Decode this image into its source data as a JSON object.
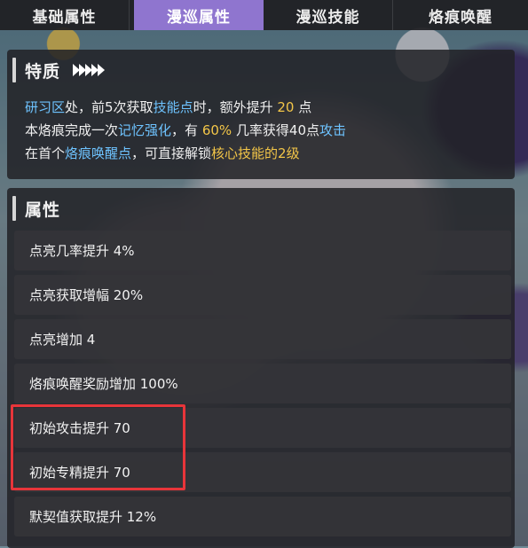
{
  "tabs": [
    {
      "label": "基础属性",
      "active": false
    },
    {
      "label": "漫巡属性",
      "active": true
    },
    {
      "label": "漫巡技能",
      "active": false
    },
    {
      "label": "烙痕唤醒",
      "active": false
    }
  ],
  "trait": {
    "title": "特质",
    "line1": {
      "p1": "研习区",
      "p2": "处，前5次获取",
      "p3": "技能点",
      "p4": "时，额外提升 ",
      "p5": "20",
      "p6": " 点"
    },
    "line2": {
      "p1": "本烙痕完成一次",
      "p2": "记忆强化",
      "p3": "，有 ",
      "p4": "60%",
      "p5": " 几率获得40点",
      "p6": "攻击"
    },
    "line3": {
      "p1": "在首个",
      "p2": "烙痕唤醒点",
      "p3": "，可直接解锁",
      "p4": "核心技能的2级"
    }
  },
  "attributes": {
    "title": "属性",
    "items": [
      "点亮几率提升 4%",
      "点亮获取增幅 20%",
      "点亮增加 4",
      "烙痕唤醒奖励增加 100%",
      "初始攻击提升 70",
      "初始专精提升 70",
      "默契值获取提升 12%"
    ]
  },
  "colors": {
    "active_tab": "#8f75cf",
    "keyword_blue": "#6ec3ff",
    "value_gold": "#f3c648",
    "highlight_red": "#e8353a"
  }
}
